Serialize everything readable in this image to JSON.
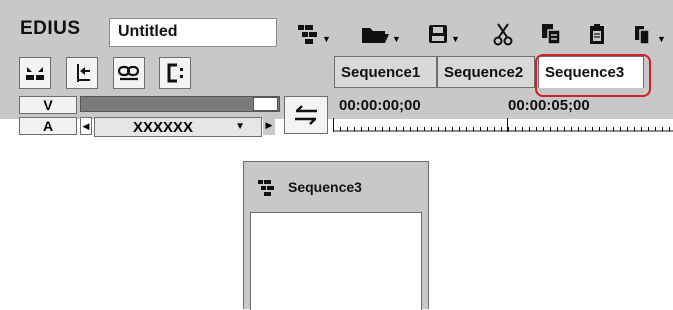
{
  "app": {
    "name": "EDIUS",
    "project_name": "Untitled"
  },
  "toolbar": {
    "icons": [
      "sequence-menu-icon",
      "open-project-icon",
      "save-project-icon",
      "cut-icon",
      "copy-icon",
      "paste-icon",
      "more-icon"
    ]
  },
  "timeline_buttons": [
    "insert-mode-icon",
    "ripple-icon",
    "link-icon",
    "group-icon"
  ],
  "sequence_tabs": [
    {
      "label": "Sequence1",
      "active": false
    },
    {
      "label": "Sequence2",
      "active": false
    },
    {
      "label": "Sequence3",
      "active": true
    }
  ],
  "tracks": {
    "video_label": "V",
    "audio_label": "A"
  },
  "channel_selector": {
    "value": "XXXXXX"
  },
  "timecodes": [
    "00:00:00;00",
    "00:00:05;00"
  ],
  "highlight_color": "#d0202c",
  "preview": {
    "title": "Sequence3",
    "icon": "sequence-icon"
  }
}
